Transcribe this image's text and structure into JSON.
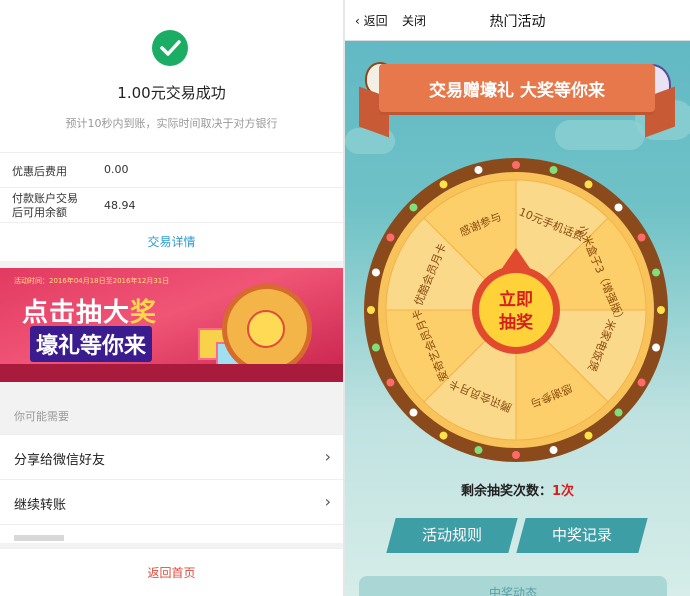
{
  "left": {
    "result": {
      "title": "1.00元交易成功",
      "note": "预计10秒内到账，实际时间取决于对方银行"
    },
    "rows": [
      {
        "label": "优惠后费用",
        "value": "0.00"
      },
      {
        "label_line1": "付款账户交易",
        "label_line2": "后可用余额",
        "value": "48.94"
      }
    ],
    "detail_link": "交易详情",
    "banner": {
      "tag": "活动时间：2016年04月18日至2016年12月31日",
      "line1_a": "点击抽大",
      "line1_b": "奖",
      "line2": "壕礼等你来"
    },
    "maybe_need": "你可能需要",
    "menu": [
      {
        "label": "分享给微信好友"
      },
      {
        "label": "继续转账"
      }
    ],
    "home": "返回首页"
  },
  "right": {
    "nav": {
      "back": "返回",
      "close": "关闭",
      "title": "热门活动"
    },
    "ribbon": "交易赠壕礼 大奖等你来",
    "wheel": {
      "hub_line1": "立即",
      "hub_line2": "抽奖",
      "prizes": [
        "10元手机话费",
        "小米盒子3（增强版）",
        "米家电饭煲",
        "感谢参与",
        "腾讯会员月卡",
        "爱奇艺会员月卡",
        "优酷会员月卡",
        "感谢参与"
      ],
      "colors": {
        "rim": "#8a4a1c",
        "slice_a": "#fbd98a",
        "slice_b": "#fdcf6a",
        "hub": "#ffd23a",
        "hub_border": "#e24a2f"
      }
    },
    "chances_label": "剩余抽奖次数：",
    "chances_value": "1次",
    "buttons": {
      "rules": "活动规则",
      "records": "中奖记录"
    },
    "bottom_card": "中奖动态"
  }
}
